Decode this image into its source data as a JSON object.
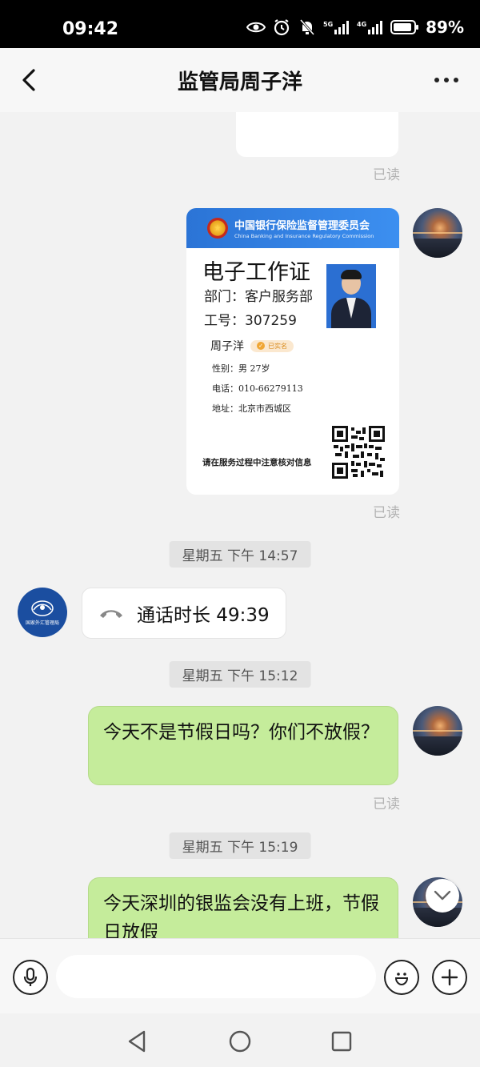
{
  "status": {
    "time": "09:42",
    "battery": "89%",
    "net1": "5G",
    "net2": "4G"
  },
  "header": {
    "title": "监管局周子洋"
  },
  "messages": {
    "read_label": "已读",
    "id_card": {
      "org_cn": "中国银行保险监督管理委员会",
      "org_en": "China Banking and Insurance Regulatory Commission",
      "title": "电子工作证",
      "dept": "部门：客户服务部",
      "staff_no": "工号：307259",
      "name": "周子洋",
      "verified": "已实名",
      "gender_age": "性别：男    27岁",
      "phone": "电话：010-66279113",
      "address": "地址：北京市西城区",
      "note": "请在服务过程中注意核对信息"
    },
    "time1": "星期五 下午 14:57",
    "call": "通话时长 49:39",
    "time2": "星期五 下午 15:12",
    "msg1": "今天不是节假日吗？你们不放假？",
    "time3": "星期五 下午 15:19",
    "msg2": "今天深圳的银监会没有上班，节假日放假"
  },
  "agency_logo_text": "国家外汇管理局",
  "colors": {
    "green_bubble": "#c5ec9b",
    "card_header": "#2b74d6",
    "agency_avatar": "#1b4ea0"
  }
}
